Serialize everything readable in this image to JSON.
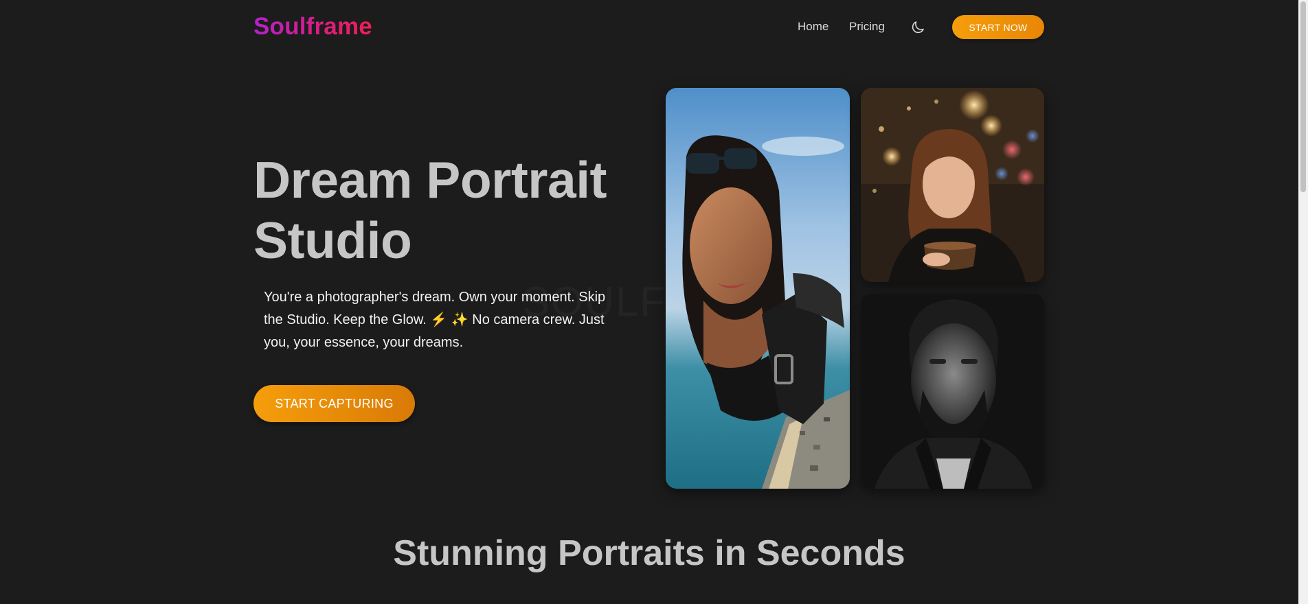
{
  "header": {
    "logo": "Soulframe",
    "nav": {
      "home": "Home",
      "pricing": "Pricing"
    },
    "theme_icon": "moon-icon",
    "cta": "START NOW"
  },
  "hero": {
    "title_line1": "Dream Portrait",
    "title_line2": "Studio",
    "subtitle": "You're a photographer's dream. Own your moment. Skip the Studio. Keep the Glow. ⚡ ✨ No camera crew. Just you, your essence, your dreams.",
    "cta": "START CAPTURING",
    "watermark": "SOULFRAME"
  },
  "gallery": {
    "images": [
      {
        "name": "portrait-skydiver",
        "alt": "portrait-skydiver"
      },
      {
        "name": "portrait-coffee-rain",
        "alt": "portrait-coffee-rain"
      },
      {
        "name": "portrait-monochrome-man",
        "alt": "portrait-monochrome-man"
      }
    ]
  },
  "section": {
    "title": "Stunning Portraits in Seconds"
  },
  "colors": {
    "background": "#1c1c1c",
    "accent": "#f59e0b",
    "logo_gradient_start": "#b322c8",
    "logo_gradient_end": "#ef1f55",
    "heading": "#c6c6c6"
  }
}
